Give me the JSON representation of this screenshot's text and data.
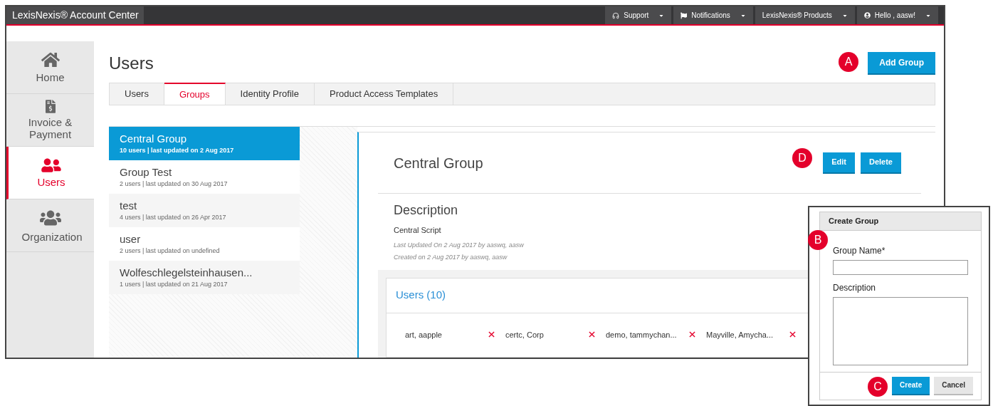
{
  "app_title": "LexisNexis® Account Center",
  "top_menu": [
    {
      "label": "Support",
      "kind": "support"
    },
    {
      "label": "Notifications",
      "kind": "flag"
    },
    {
      "label": "LexisNexis® Products",
      "kind": "plain"
    },
    {
      "label": "Hello , aasw!",
      "kind": "user"
    }
  ],
  "sidebar": [
    {
      "label": "Home",
      "kind": "home",
      "selected": false
    },
    {
      "label": "Invoice & Payment",
      "kind": "invoice",
      "selected": false
    },
    {
      "label": "Users",
      "kind": "users",
      "selected": true
    },
    {
      "label": "Organization",
      "kind": "organization",
      "selected": false
    }
  ],
  "page_title": "Users",
  "add_button": "Add Group",
  "tabs": [
    {
      "label": "Users",
      "selected": false
    },
    {
      "label": "Groups",
      "selected": true
    },
    {
      "label": "Identity Profile",
      "selected": false
    },
    {
      "label": "Product Access Templates",
      "selected": false
    }
  ],
  "groups": [
    {
      "name": "Central Group",
      "meta": "10 users | last updated on 2 Aug 2017",
      "selected": true
    },
    {
      "name": "Group Test",
      "meta": "2 users | last updated on 30 Aug 2017",
      "selected": false
    },
    {
      "name": "test",
      "meta": "4 users | last updated on 26 Apr 2017",
      "selected": false
    },
    {
      "name": "user",
      "meta": "2 users | last updated on undefined",
      "selected": false
    },
    {
      "name": "Wolfeschlegelsteinhausen...",
      "meta": "1 users | last updated on 21 Aug 2017",
      "selected": false
    }
  ],
  "detail": {
    "title": "Central Group",
    "buttons": [
      "Edit",
      "Delete"
    ],
    "description_heading": "Description",
    "description": "Central Script",
    "updated": "Last Updated On 2 Aug 2017 by aaswq, aasw",
    "created": "Created on 2 Aug 2017 by aaswq, aasw",
    "members_heading": "Users (10)",
    "members": [
      "art, aapple",
      "certc, Corp",
      "demo, tammychan...",
      "Mayville, Amycha..."
    ]
  },
  "dialog": {
    "title": "Create Group",
    "fields": [
      {
        "label": "Group Name*",
        "kind": "input"
      },
      {
        "label": "Description",
        "kind": "textarea"
      }
    ],
    "buttons": [
      {
        "label": "Create",
        "kind": "primary"
      },
      {
        "label": "Cancel",
        "kind": "secondary"
      }
    ]
  },
  "callouts": [
    "A",
    "B",
    "C",
    "D"
  ]
}
